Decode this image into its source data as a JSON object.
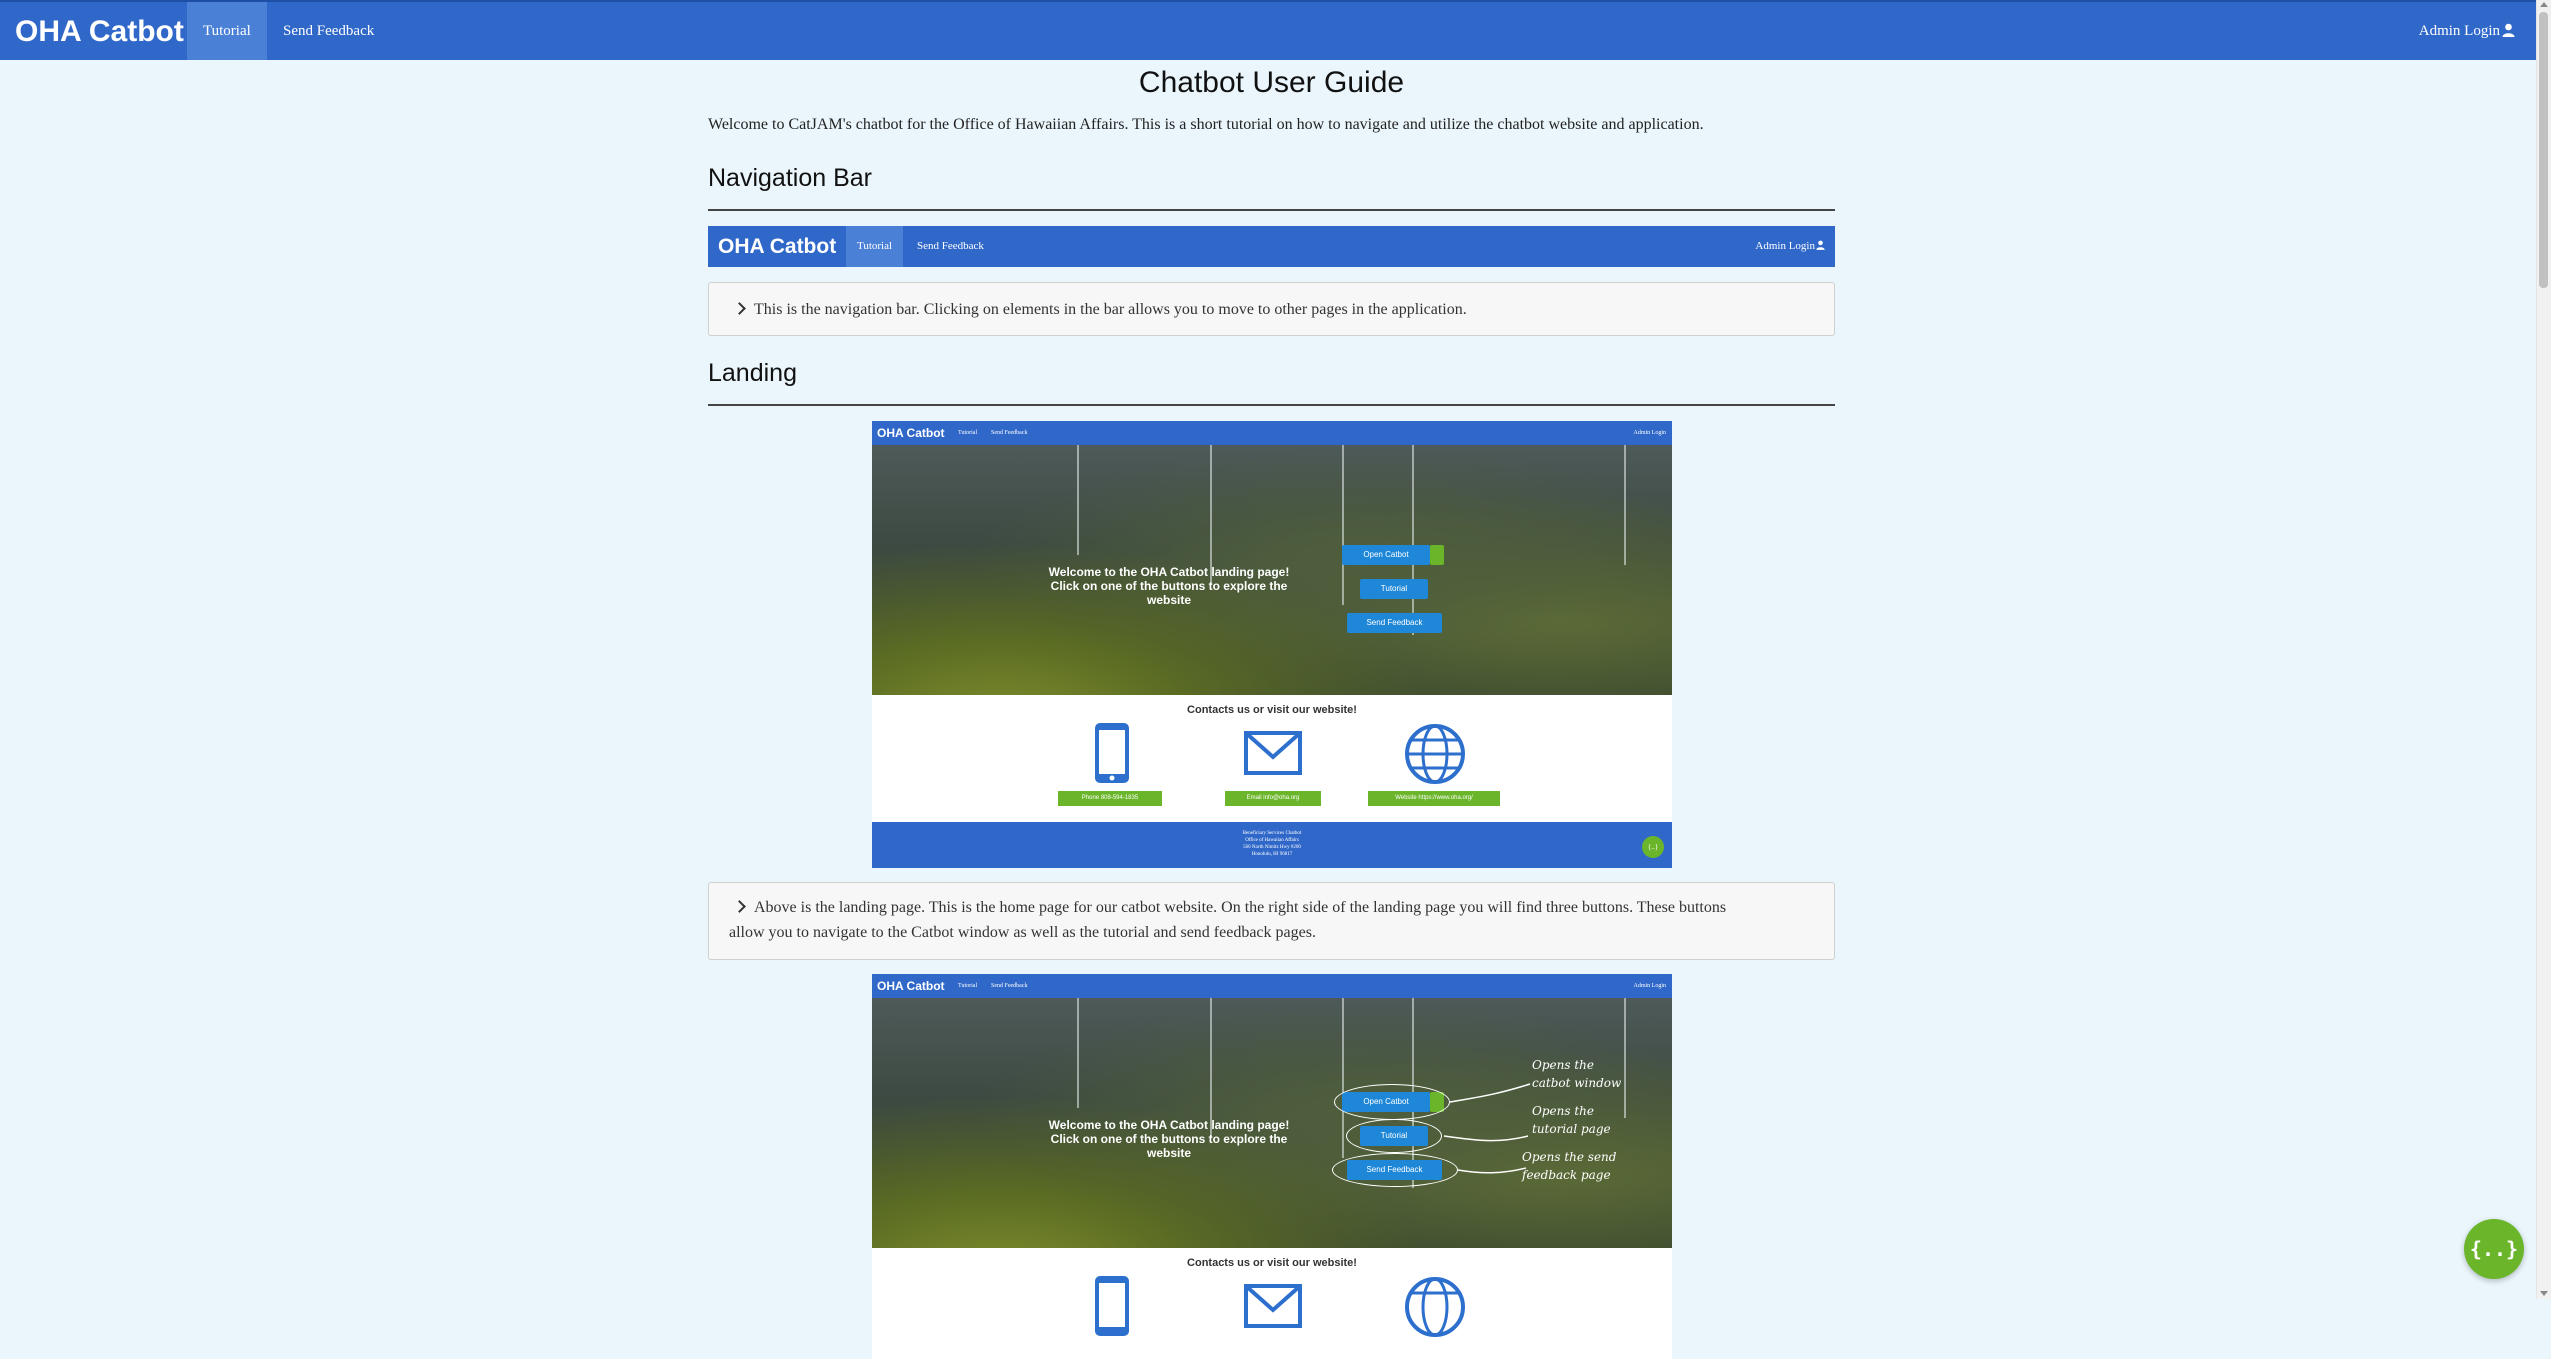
{
  "navbar": {
    "brand": "OHA Catbot",
    "links": [
      "Tutorial",
      "Send Feedback"
    ],
    "admin_label": "Admin Login"
  },
  "page": {
    "title": "Chatbot User Guide",
    "intro": "Welcome to CatJAM's chatbot for the Office of Hawaiian Affairs. This is a short tutorial on how to navigate and utilize the chatbot website and application."
  },
  "sections": {
    "navigation": {
      "heading": "Navigation Bar",
      "description": "This is the navigation bar. Clicking on elements in the bar allows you to move to other pages in the application."
    },
    "landing": {
      "heading": "Landing",
      "description_line1": "Above is the landing page. This is the home page for our catbot website. On the right side of the landing page you will find three buttons. These buttons",
      "description_line2": "allow you to navigate to the Catbot window as well as the tutorial and send feedback pages."
    }
  },
  "landing_shot": {
    "brand": "OHA Catbot",
    "links": [
      "Tutorial",
      "Send Feedback"
    ],
    "admin": "Admin Login",
    "hero_line1": "Welcome to the OHA Catbot landing page!",
    "hero_line2": "Click on one of the buttons to explore the",
    "hero_line3": "website",
    "btn_open": "Open Catbot",
    "btn_tutorial": "Tutorial",
    "btn_feedback": "Send Feedback",
    "contact_title": "Contacts us or visit our website!",
    "phone": "Phone  808-594-1835",
    "email": "Email  info@oha.org",
    "website": "Website  https://www.oha.org/",
    "footer_line1": "Beneficiary Services Chatbot",
    "footer_line2": "Office of Hawaiian Affairs",
    "footer_line3": "560 North Nimitz Hwy #200",
    "footer_line4": "Honolulu, HI 96817",
    "annotations": [
      "Opens the",
      "catbot window",
      "Opens the",
      "tutorial page",
      "Opens the send",
      "feedback page"
    ]
  },
  "chat_fab": {
    "label": "{..}"
  },
  "colors": {
    "navbar": "#3068c9",
    "active_tab": "#4a80d6",
    "accent_green": "#6bb52a",
    "page_bg": "#eaf6fc"
  }
}
